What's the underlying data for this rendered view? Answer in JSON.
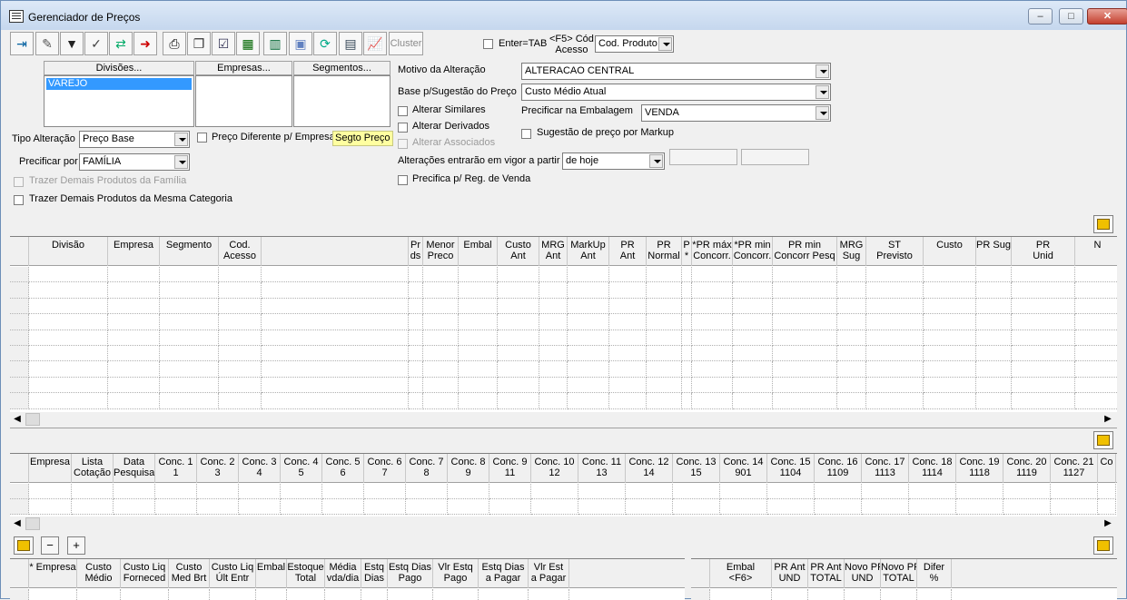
{
  "window": {
    "title": "Gerenciador de Preços"
  },
  "toolbar": {
    "icons": [
      "exit-icon",
      "eraser-icon",
      "filter-icon",
      "filter-check-icon",
      "swap-icon",
      "arrow-red-icon",
      "print-icon",
      "copy-icon",
      "edit-list-icon",
      "grid-add-icon",
      "table-icon",
      "save-icon",
      "refresh-icon",
      "columns-icon",
      "chart-icon"
    ],
    "cluster_label": "Cluster"
  },
  "access": {
    "enter_tab_label": "Enter=TAB",
    "f5_label": "<F5> Cód\nAcesso",
    "select_value": "Cod. Produto"
  },
  "lists": {
    "divisoes_label": "Divisões...",
    "empresas_label": "Empresas...",
    "segmentos_label": "Segmentos...",
    "divisoes_items": [
      "VAREJO"
    ]
  },
  "form": {
    "tipo_alteracao_label": "Tipo Alteração",
    "tipo_alteracao_value": "Preço Base",
    "preco_diferente_label": "Preço Diferente p/ Empresa",
    "segto_preco_label": "Segto Preço",
    "precificar_por_label": "Precificar por",
    "precificar_por_value": "FAMÍLIA",
    "trazer_familia_label": "Trazer Demais Produtos da Família",
    "trazer_categoria_label": "Trazer Demais Produtos da Mesma Categoria",
    "motivo_label": "Motivo da Alteração",
    "motivo_value": "ALTERACAO CENTRAL",
    "base_label": "Base p/Sugestão do Preço",
    "base_value": "Custo Médio Atual",
    "alterar_similares_label": "Alterar Similares",
    "alterar_derivados_label": "Alterar Derivados",
    "alterar_associados_label": "Alterar Associados",
    "precificar_embalagem_label": "Precificar na Embalagem",
    "precificar_embalagem_value": "VENDA",
    "sugestao_markup_label": "Sugestão de preço por Markup",
    "vigor_label": "Alterações entrarão em vigor a partir",
    "vigor_value": "de hoje",
    "precifica_reg_label": "Precifica p/ Reg. de Venda"
  },
  "grid1": {
    "headers": [
      "Divisão",
      "Empresa",
      "Segmento",
      "Cod.\nAcesso",
      "",
      "Pr\nds",
      "Menor\nPreco",
      "Embal",
      "Custo\nAnt",
      "MRG\nAnt",
      "MarkUp\nAnt",
      "PR\nAnt",
      "PR\nNormal",
      "P\n*",
      "*PR máx\nConcorr.",
      "*PR min\nConcorr.",
      "PR min\nConcorr Pesq",
      "MRG\nSug",
      "ST\nPrevisto",
      "Custo",
      "PR Sug",
      "PR\nUnid",
      "N"
    ]
  },
  "grid2": {
    "headers": [
      "Empresa",
      "Lista\nCotação",
      "Data\nPesquisa",
      "Conc. 1\n1",
      "Conc. 2\n3",
      "Conc. 3\n4",
      "Conc. 4\n5",
      "Conc. 5\n6",
      "Conc. 6\n7",
      "Conc. 7\n8",
      "Conc. 8\n9",
      "Conc. 9\n11",
      "Conc. 10\n12",
      "Conc. 11\n13",
      "Conc. 12\n14",
      "Conc. 13\n15",
      "Conc. 14\n901",
      "Conc. 15\n1104",
      "Conc. 16\n1109",
      "Conc. 17\n1113",
      "Conc. 18\n1114",
      "Conc. 19\n1118",
      "Conc. 20\n1119",
      "Conc. 21\n1127",
      "Co"
    ]
  },
  "grid3": {
    "headers_left": [
      "* Empresa",
      "Custo\nMédio",
      "Custo Liq\nForneced",
      "Custo\nMed Brt",
      "Custo Liq\nÚlt Entr",
      "Embal",
      "Estoque\nTotal",
      "Média\nvda/dia",
      "Estq\nDias",
      "Estq Dias\nPago",
      "Vlr Estq\nPago",
      "Estq Dias\na Pagar",
      "Vlr Est\na Pagar"
    ],
    "headers_right": [
      "Embal\n<F6>",
      "PR Ant\nUND",
      "PR Ant\nTOTAL",
      "Novo PR\nUND",
      "Novo PR\nTOTAL",
      "Difer\n%"
    ]
  },
  "buttons": {
    "minus": "−",
    "plus": "+"
  }
}
